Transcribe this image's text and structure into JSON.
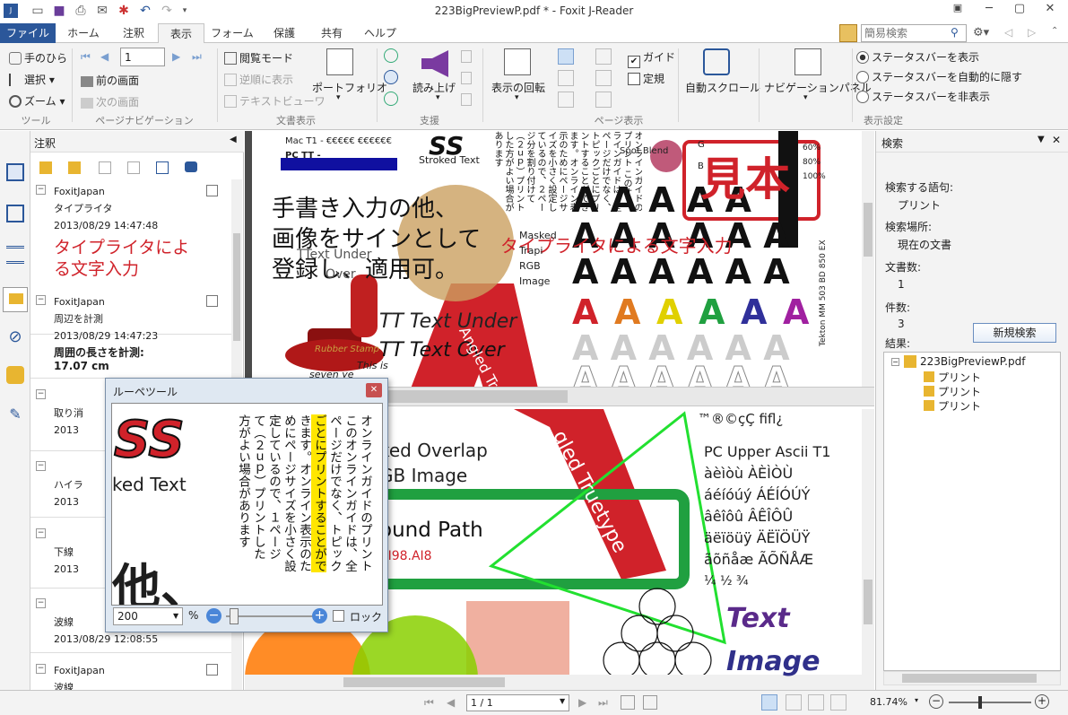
{
  "window": {
    "title": "223BigPreviewP.pdf * - Foxit J-Reader"
  },
  "search_box": {
    "placeholder": "簡易検索"
  },
  "tabs": [
    "ファイル",
    "ホーム",
    "注釈",
    "表示",
    "フォーム",
    "保護",
    "共有",
    "ヘルプ"
  ],
  "ribbon": {
    "tools": {
      "hand": "手のひら",
      "select": "選択",
      "zoom": "ズーム",
      "group": "ツール"
    },
    "pagenav": {
      "page_value": "1",
      "prev_screen": "前の画面",
      "next_screen": "次の画面",
      "group": "ページナビゲーション"
    },
    "docview": {
      "reading_mode": "閲覧モード",
      "reverse": "逆順に表示",
      "text_viewer": "テキストビューワ",
      "portfolio": "ポートフォリオ",
      "group": "文書表示"
    },
    "assist": {
      "read_aloud": "読み上げ",
      "group": "支援"
    },
    "pageview": {
      "rotate": "表示の回転",
      "guide": "ガイド",
      "ruler": "定規",
      "group": "ページ表示"
    },
    "autoscroll": "自動スクロール",
    "navpanel": "ナビゲーションパネル",
    "display": {
      "show_status": "ステータスバーを表示",
      "auto_hide": "ステータスバーを自動的に隠す",
      "hide_status": "ステータスバーを非表示",
      "group": "表示設定"
    }
  },
  "annotations_panel": {
    "title": "注釈",
    "items": [
      {
        "author": "FoxitJapan",
        "type": "タイプライタ",
        "date": "2013/08/29 14:47:48",
        "content": "タイプライタによる文字入力"
      },
      {
        "author": "FoxitJapan",
        "type": "周辺を計測",
        "date": "2013/08/29 14:47:23",
        "content": "周囲の長さを計測:\n17.07 cm"
      },
      {
        "author": "",
        "type": "取り消",
        "date": "2013",
        "content": ""
      },
      {
        "author": "",
        "type": "ハイラ",
        "date": "2013",
        "content": ""
      },
      {
        "author": "",
        "type": "下線",
        "date": "2013",
        "content": ""
      },
      {
        "author": "",
        "type": "波線",
        "date": "2013/08/29 12:08:55",
        "content": ""
      },
      {
        "author": "FoxitJapan",
        "type": "波線",
        "date": "",
        "content": ""
      }
    ]
  },
  "document": {
    "ss_label": "SS",
    "stroked_text": "Stroked Text",
    "mac_t1": "Mac T1 - €€€€€ €€€€€€",
    "pc_tt": "PC TT -",
    "handwriting": [
      "手書き入力の他、",
      "画像をサインとして",
      "登録し、適用可。"
    ],
    "typewriter": "タイプライタによる文字入力",
    "spot_blend": "Spot Blend",
    "masked": [
      "Masked",
      "Trapi",
      "RGB",
      "Image"
    ],
    "stamp": "見本",
    "tt_under": "TT Text Under",
    "tt_over": "TT Text Over",
    "ttext_under": "TText Under",
    "over": "Over",
    "angled": "Angled Truetype",
    "rubber_stamp": "Rubber Stamp",
    "this_is": "This is",
    "seven": "seven ye",
    "tekton": "Tekton MM 503 BD 850 EX",
    "cmyk_pct": [
      "60%",
      "80%",
      "100%"
    ],
    "cmyk_letters": [
      "G",
      "B"
    ],
    "masked_overlap": "ked Overlap",
    "rgb_image": "GB Image",
    "compound": "ound Path",
    "ai_number": "AI98.AI8",
    "symbols": "™®©çÇ fifl¿",
    "pc_upper": "PC Upper Ascii T1",
    "ascii_rows": [
      "àèìòù ÀÈÌÒÙ",
      "áéíóúý ÁÉÍÓÚÝ",
      "âêîôû ÂÊÎÔÛ",
      "äëïöüÿ ÄËÏÖÜŸ",
      "ãõñåæ ÃÕÑÅÆ",
      "¼ ½ ¾"
    ],
    "text_word": "Text",
    "image_word": "Image",
    "angled2": "gled Truetype",
    "guide_text": "オンラインガイドのプリント このオンラインガイドは、全ページだけでなく、トピックごとにプリントすることができます。オンライン表示のためにページサイズを小さく設定しているので、２ページ分を割り付けて（２ｕｐ）プリントした方がよい場合があります"
  },
  "loupe": {
    "title": "ルーペツール",
    "zoom_value": "200",
    "percent": "%",
    "lock": "ロック",
    "col1": "オンラインガイドのプリント",
    "col2": "このオンラインガイドは、全",
    "col3": "ページだけでなく、トピック",
    "col4": "ごとにプリントすることがで",
    "col5": "きます。オンライン表示のた",
    "col6": "めにページサイズを小さく設",
    "col7": "定しているので、１ページ",
    "col8": "て（２ｕｐ）プリントした",
    "col8b": "を割り付け",
    "col9": "方がよい場合があります",
    "ss": "SS",
    "stroked": "ked Text",
    "kanji": "他、"
  },
  "search_panel": {
    "title": "検索",
    "term_label": "検索する語句:",
    "term": "プリント",
    "location_label": "検索場所:",
    "location": "現在の文書",
    "docs_label": "文書数:",
    "docs": "1",
    "hits_label": "件数:",
    "hits": "3",
    "new_search": "新規検索",
    "results_label": "結果:",
    "file": "223BigPreviewP.pdf",
    "results": [
      "プリント",
      "プリント",
      "プリント"
    ]
  },
  "statusbar": {
    "page": "1 / 1",
    "zoom": "81.74%"
  },
  "colors": {
    "accent": "#2b579a",
    "red": "#d0222a",
    "green": "#22c04a",
    "highlight": "#ffe600"
  }
}
